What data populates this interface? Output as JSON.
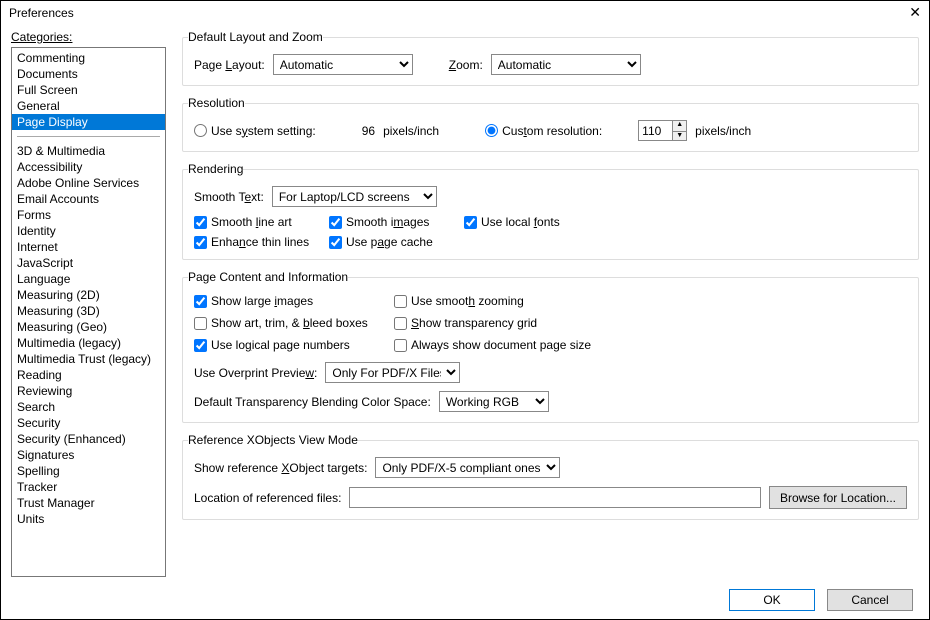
{
  "window": {
    "title": "Preferences"
  },
  "categories": {
    "label": "Categories:",
    "group1": [
      "Commenting",
      "Documents",
      "Full Screen",
      "General",
      "Page Display"
    ],
    "selected": "Page Display",
    "group2": [
      "3D & Multimedia",
      "Accessibility",
      "Adobe Online Services",
      "Email Accounts",
      "Forms",
      "Identity",
      "Internet",
      "JavaScript",
      "Language",
      "Measuring (2D)",
      "Measuring (3D)",
      "Measuring (Geo)",
      "Multimedia (legacy)",
      "Multimedia Trust (legacy)",
      "Reading",
      "Reviewing",
      "Search",
      "Security",
      "Security (Enhanced)",
      "Signatures",
      "Spelling",
      "Tracker",
      "Trust Manager",
      "Units"
    ]
  },
  "layout": {
    "legend": "Default Layout and Zoom",
    "page_layout_label": "Page Layout:",
    "page_layout_value": "Automatic",
    "zoom_label": "Zoom:",
    "zoom_value": "Automatic"
  },
  "resolution": {
    "legend": "Resolution",
    "use_system_label": "Use system setting:",
    "system_value": "96",
    "units": "pixels/inch",
    "custom_label": "Custom resolution:",
    "custom_value": "110",
    "selected": "custom"
  },
  "rendering": {
    "legend": "Rendering",
    "smooth_text_label": "Smooth Text:",
    "smooth_text_value": "For Laptop/LCD screens",
    "smooth_line_art": {
      "label": "Smooth line art",
      "checked": true
    },
    "smooth_images": {
      "label": "Smooth images",
      "checked": true
    },
    "use_local_fonts": {
      "label": "Use local fonts",
      "checked": true
    },
    "enhance_thin_lines": {
      "label": "Enhance thin lines",
      "checked": true
    },
    "use_page_cache": {
      "label": "Use page cache",
      "checked": true
    }
  },
  "content": {
    "legend": "Page Content and Information",
    "show_large_images": {
      "label": "Show large images",
      "checked": true
    },
    "use_smooth_zooming": {
      "label": "Use smooth zooming",
      "checked": false
    },
    "show_art_trim": {
      "label": "Show art, trim, & bleed boxes",
      "checked": false
    },
    "show_transparency_grid": {
      "label": "Show transparency grid",
      "checked": false
    },
    "use_logical_page": {
      "label": "Use logical page numbers",
      "checked": true
    },
    "always_show_doc_size": {
      "label": "Always show document page size",
      "checked": false
    },
    "overprint_label": "Use Overprint Preview:",
    "overprint_value": "Only For PDF/X Files",
    "blend_label": "Default Transparency Blending Color Space:",
    "blend_value": "Working RGB"
  },
  "xobjects": {
    "legend": "Reference XObjects View Mode",
    "show_label": "Show reference XObject targets:",
    "show_value": "Only PDF/X-5 compliant ones",
    "location_label": "Location of referenced files:",
    "location_value": "",
    "browse_label": "Browse for Location..."
  },
  "buttons": {
    "ok": "OK",
    "cancel": "Cancel"
  }
}
